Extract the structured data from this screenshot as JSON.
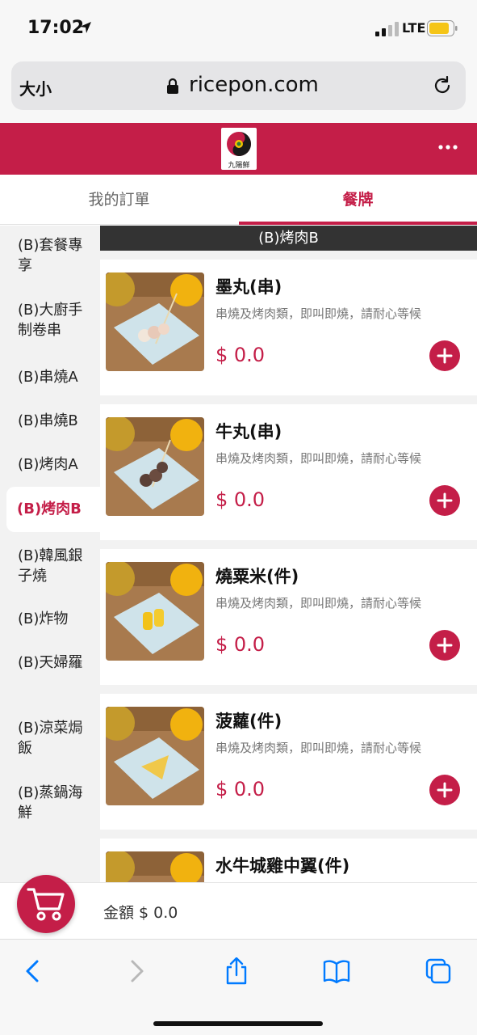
{
  "status_bar": {
    "time": "17:02",
    "network": "LTE"
  },
  "browser": {
    "text_size_label": "大小",
    "url": "ricepon.com"
  },
  "header": {
    "logo_text": "九陽鮮"
  },
  "tabs": [
    {
      "label": "我的訂單"
    },
    {
      "label": "餐牌"
    }
  ],
  "sidebar": {
    "categories": [
      {
        "label": "(B)套餐專享"
      },
      {
        "label": "(B)大廚手制卷串"
      },
      {
        "label": "(B)串燒A"
      },
      {
        "label": "(B)串燒B"
      },
      {
        "label": "(B)烤肉A"
      },
      {
        "label": "(B)烤肉B"
      },
      {
        "label": "(B)韓風銀子燒"
      },
      {
        "label": "(B)炸物"
      },
      {
        "label": "(B)天婦羅"
      },
      {
        "label": "(B)涼菜焗飯"
      },
      {
        "label": "(B)蒸鍋海鮮"
      }
    ],
    "active_index": 5
  },
  "section_title": "(B)烤肉B",
  "items": [
    {
      "name": "墨丸(串)",
      "desc": "串燒及烤肉類，即叫即燒，請耐心等候",
      "price": "$ 0.0"
    },
    {
      "name": "牛丸(串)",
      "desc": "串燒及烤肉類，即叫即燒，請耐心等候",
      "price": "$ 0.0"
    },
    {
      "name": "燒粟米(件)",
      "desc": "串燒及烤肉類，即叫即燒，請耐心等候",
      "price": "$ 0.0"
    },
    {
      "name": "菠蘿(件)",
      "desc": "串燒及烤肉類，即叫即燒，請耐心等候",
      "price": "$ 0.0"
    },
    {
      "name": "水牛城雞中翼(件)"
    }
  ],
  "cart": {
    "total_label": "金額 $ 0.0"
  },
  "colors": {
    "brand": "#c41e48",
    "section_bar": "#333333",
    "ios_blue": "#007aff"
  }
}
